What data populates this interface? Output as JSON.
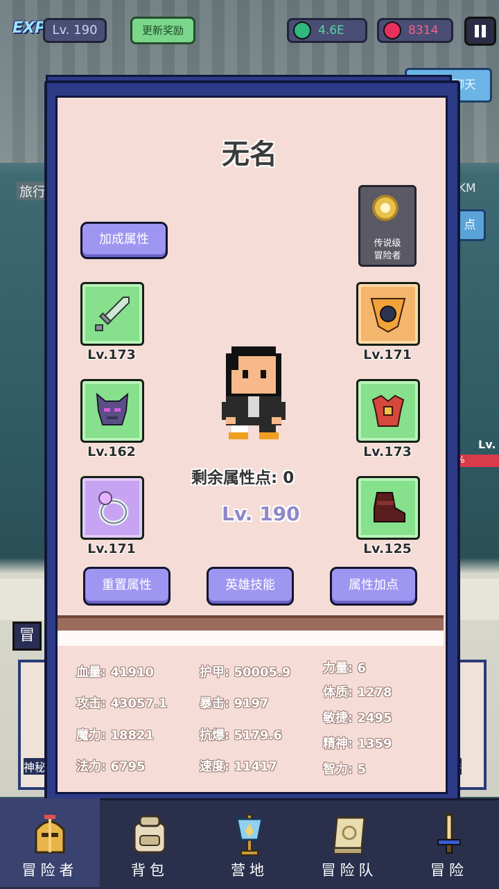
{
  "topbar": {
    "exp_logo": "EXP",
    "level": "Lv. 190",
    "update_button": "更新奖励",
    "gems": "4.6E",
    "rubies": "8314"
  },
  "background": {
    "right_button": "聊天",
    "travel": "旅行",
    "distance": "8KM",
    "right_button2": "点",
    "enemy_level": "Lv.",
    "enemy_hp": "0%",
    "adventure_tab": "冒",
    "left_card": "神秘",
    "right_card": "件"
  },
  "hero": {
    "name": "无名",
    "bonus_button": "加成属性",
    "legend_line1": "传说级",
    "legend_line2": "冒险者",
    "points_label": "剩余属性点: 0",
    "level": "Lv. 190",
    "reset_button": "重置属性",
    "skill_button": "英雄技能",
    "addpoint_button": "属性加点"
  },
  "equipment": {
    "weapon_level": "Lv.173",
    "helmet_level": "Lv.162",
    "ring_level": "Lv.171",
    "shoulder_level": "Lv.171",
    "armor_level": "Lv.173",
    "boots_level": "Lv.125"
  },
  "stats": {
    "hp": "血量: 41910",
    "attack": "攻击: 43057.1",
    "magic": "魔力: 18821",
    "mana": "法力: 6795",
    "armor": "护甲: 50005.9",
    "crit": "暴击: 9197",
    "anticrit": "抗爆: 5179.6",
    "speed": "速度: 11417",
    "strength": "力量: 6",
    "constitution": "体质: 1278",
    "agility": "敏捷: 2495",
    "spirit": "精神: 1359",
    "intellect": "智力: 5"
  },
  "nav": [
    {
      "label": "冒险者",
      "icon": "knight-helmet-icon"
    },
    {
      "label": "背包",
      "icon": "backpack-icon"
    },
    {
      "label": "营地",
      "icon": "camp-banner-icon"
    },
    {
      "label": "冒险队",
      "icon": "guild-book-icon"
    },
    {
      "label": "冒险",
      "icon": "sword-icon"
    }
  ],
  "colors": {
    "panel": "#f5dcd6",
    "panel_border": "#2d3b86",
    "button": "#9e96f0",
    "slot_green": "#86e08c",
    "slot_purple": "#c7a4f2",
    "slot_orange": "#f4b56c"
  }
}
